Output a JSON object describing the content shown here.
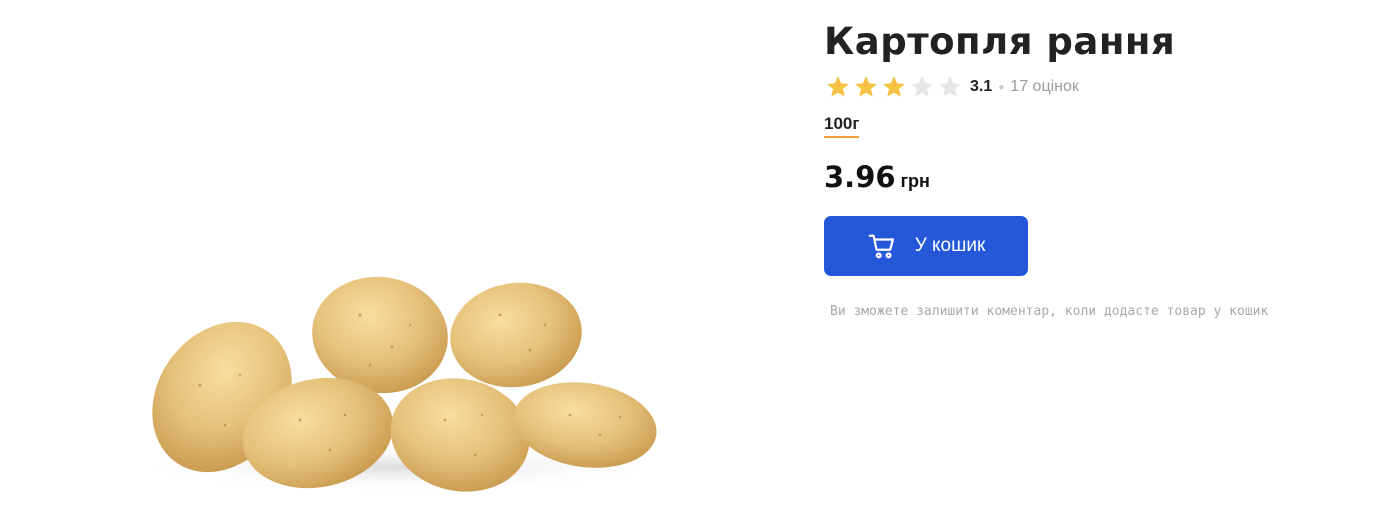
{
  "product": {
    "title": "Картопля рання",
    "rating": {
      "value": "3.1",
      "stars_filled": 3,
      "stars_total": 5,
      "count_label": "17 оцінок"
    },
    "weight_label": "100г",
    "price": {
      "value": "3.96",
      "currency": "грн"
    },
    "add_to_cart_label": "У кошик",
    "comment_note": "Ви зможете залишити коментар, коли додасте товар у кошик",
    "image_alt_icon": "potatoes-image"
  },
  "colors": {
    "button": "#2558d9",
    "star_filled": "#f5c242",
    "star_empty": "#e6e6e6",
    "weight_underline": "#f0a23a"
  }
}
